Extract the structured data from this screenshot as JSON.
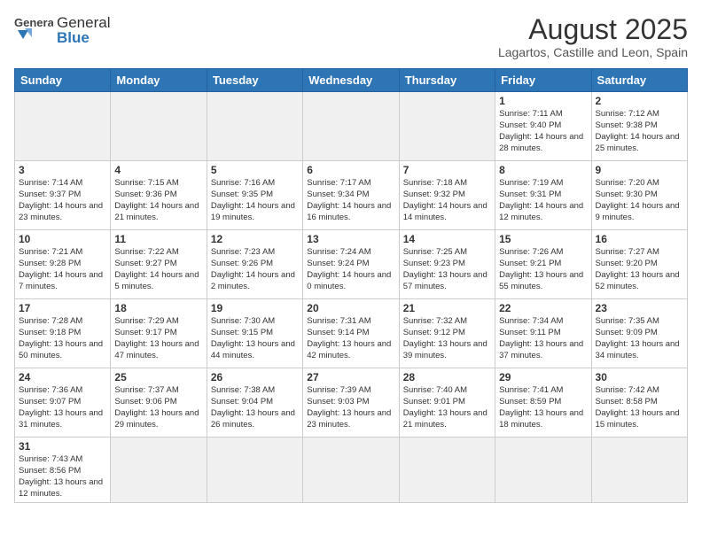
{
  "header": {
    "logo_general": "General",
    "logo_blue": "Blue",
    "month_title": "August 2025",
    "location": "Lagartos, Castille and Leon, Spain"
  },
  "weekdays": [
    "Sunday",
    "Monday",
    "Tuesday",
    "Wednesday",
    "Thursday",
    "Friday",
    "Saturday"
  ],
  "weeks": [
    [
      {
        "day": "",
        "info": ""
      },
      {
        "day": "",
        "info": ""
      },
      {
        "day": "",
        "info": ""
      },
      {
        "day": "",
        "info": ""
      },
      {
        "day": "",
        "info": ""
      },
      {
        "day": "1",
        "info": "Sunrise: 7:11 AM\nSunset: 9:40 PM\nDaylight: 14 hours and 28 minutes."
      },
      {
        "day": "2",
        "info": "Sunrise: 7:12 AM\nSunset: 9:38 PM\nDaylight: 14 hours and 25 minutes."
      }
    ],
    [
      {
        "day": "3",
        "info": "Sunrise: 7:14 AM\nSunset: 9:37 PM\nDaylight: 14 hours and 23 minutes."
      },
      {
        "day": "4",
        "info": "Sunrise: 7:15 AM\nSunset: 9:36 PM\nDaylight: 14 hours and 21 minutes."
      },
      {
        "day": "5",
        "info": "Sunrise: 7:16 AM\nSunset: 9:35 PM\nDaylight: 14 hours and 19 minutes."
      },
      {
        "day": "6",
        "info": "Sunrise: 7:17 AM\nSunset: 9:34 PM\nDaylight: 14 hours and 16 minutes."
      },
      {
        "day": "7",
        "info": "Sunrise: 7:18 AM\nSunset: 9:32 PM\nDaylight: 14 hours and 14 minutes."
      },
      {
        "day": "8",
        "info": "Sunrise: 7:19 AM\nSunset: 9:31 PM\nDaylight: 14 hours and 12 minutes."
      },
      {
        "day": "9",
        "info": "Sunrise: 7:20 AM\nSunset: 9:30 PM\nDaylight: 14 hours and 9 minutes."
      }
    ],
    [
      {
        "day": "10",
        "info": "Sunrise: 7:21 AM\nSunset: 9:28 PM\nDaylight: 14 hours and 7 minutes."
      },
      {
        "day": "11",
        "info": "Sunrise: 7:22 AM\nSunset: 9:27 PM\nDaylight: 14 hours and 5 minutes."
      },
      {
        "day": "12",
        "info": "Sunrise: 7:23 AM\nSunset: 9:26 PM\nDaylight: 14 hours and 2 minutes."
      },
      {
        "day": "13",
        "info": "Sunrise: 7:24 AM\nSunset: 9:24 PM\nDaylight: 14 hours and 0 minutes."
      },
      {
        "day": "14",
        "info": "Sunrise: 7:25 AM\nSunset: 9:23 PM\nDaylight: 13 hours and 57 minutes."
      },
      {
        "day": "15",
        "info": "Sunrise: 7:26 AM\nSunset: 9:21 PM\nDaylight: 13 hours and 55 minutes."
      },
      {
        "day": "16",
        "info": "Sunrise: 7:27 AM\nSunset: 9:20 PM\nDaylight: 13 hours and 52 minutes."
      }
    ],
    [
      {
        "day": "17",
        "info": "Sunrise: 7:28 AM\nSunset: 9:18 PM\nDaylight: 13 hours and 50 minutes."
      },
      {
        "day": "18",
        "info": "Sunrise: 7:29 AM\nSunset: 9:17 PM\nDaylight: 13 hours and 47 minutes."
      },
      {
        "day": "19",
        "info": "Sunrise: 7:30 AM\nSunset: 9:15 PM\nDaylight: 13 hours and 44 minutes."
      },
      {
        "day": "20",
        "info": "Sunrise: 7:31 AM\nSunset: 9:14 PM\nDaylight: 13 hours and 42 minutes."
      },
      {
        "day": "21",
        "info": "Sunrise: 7:32 AM\nSunset: 9:12 PM\nDaylight: 13 hours and 39 minutes."
      },
      {
        "day": "22",
        "info": "Sunrise: 7:34 AM\nSunset: 9:11 PM\nDaylight: 13 hours and 37 minutes."
      },
      {
        "day": "23",
        "info": "Sunrise: 7:35 AM\nSunset: 9:09 PM\nDaylight: 13 hours and 34 minutes."
      }
    ],
    [
      {
        "day": "24",
        "info": "Sunrise: 7:36 AM\nSunset: 9:07 PM\nDaylight: 13 hours and 31 minutes."
      },
      {
        "day": "25",
        "info": "Sunrise: 7:37 AM\nSunset: 9:06 PM\nDaylight: 13 hours and 29 minutes."
      },
      {
        "day": "26",
        "info": "Sunrise: 7:38 AM\nSunset: 9:04 PM\nDaylight: 13 hours and 26 minutes."
      },
      {
        "day": "27",
        "info": "Sunrise: 7:39 AM\nSunset: 9:03 PM\nDaylight: 13 hours and 23 minutes."
      },
      {
        "day": "28",
        "info": "Sunrise: 7:40 AM\nSunset: 9:01 PM\nDaylight: 13 hours and 21 minutes."
      },
      {
        "day": "29",
        "info": "Sunrise: 7:41 AM\nSunset: 8:59 PM\nDaylight: 13 hours and 18 minutes."
      },
      {
        "day": "30",
        "info": "Sunrise: 7:42 AM\nSunset: 8:58 PM\nDaylight: 13 hours and 15 minutes."
      }
    ],
    [
      {
        "day": "31",
        "info": "Sunrise: 7:43 AM\nSunset: 8:56 PM\nDaylight: 13 hours and 12 minutes."
      },
      {
        "day": "",
        "info": ""
      },
      {
        "day": "",
        "info": ""
      },
      {
        "day": "",
        "info": ""
      },
      {
        "day": "",
        "info": ""
      },
      {
        "day": "",
        "info": ""
      },
      {
        "day": "",
        "info": ""
      }
    ]
  ]
}
